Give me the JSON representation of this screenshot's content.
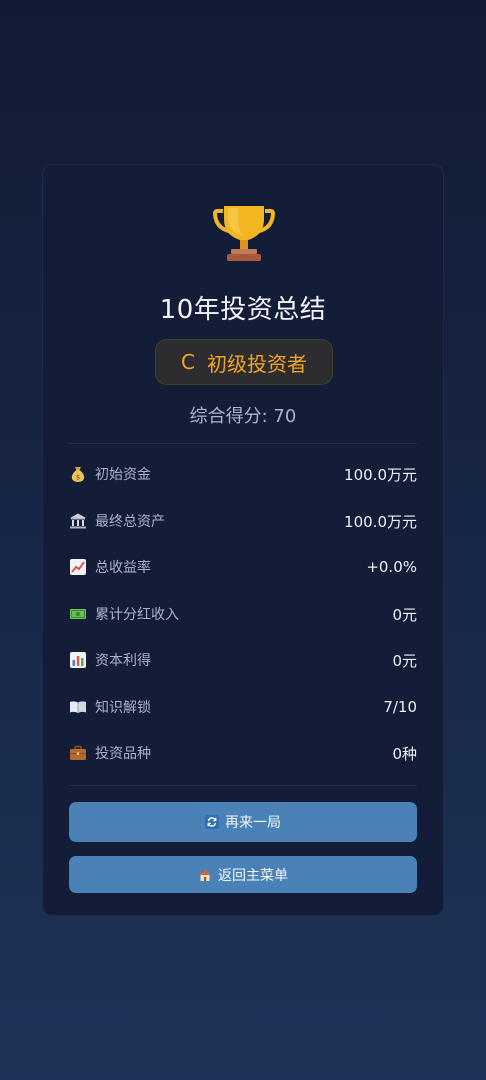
{
  "summary": {
    "title": "10年投资总结",
    "grade_letter": "C",
    "grade_label": "初级投资者",
    "score_text": "综合得分: 70"
  },
  "stats": [
    {
      "icon": "money-bag-icon",
      "label": "初始资金",
      "value": "100.0万元"
    },
    {
      "icon": "bank-icon",
      "label": "最终总资产",
      "value": "100.0万元"
    },
    {
      "icon": "chart-up-icon",
      "label": "总收益率",
      "value": "+0.0%"
    },
    {
      "icon": "banknote-icon",
      "label": "累计分红收入",
      "value": "0元"
    },
    {
      "icon": "bar-chart-icon",
      "label": "资本利得",
      "value": "0元"
    },
    {
      "icon": "open-book-icon",
      "label": "知识解锁",
      "value": "7/10"
    },
    {
      "icon": "briefcase-icon",
      "label": "投资品种",
      "value": "0种"
    }
  ],
  "buttons": {
    "replay_label": "再来一局",
    "menu_label": "返回主菜单"
  },
  "colors": {
    "accent": "#f0a525",
    "button": "#4a82b8",
    "card": "#141d38"
  }
}
